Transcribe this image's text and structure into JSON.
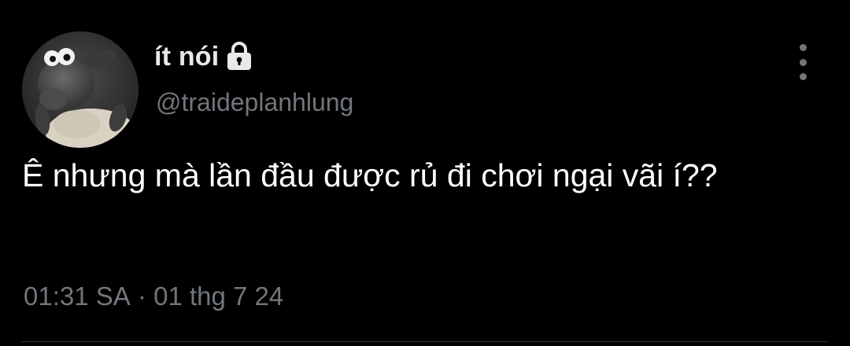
{
  "author": {
    "display_name": "ít nói",
    "handle": "@traideplanhlung",
    "protected_icon": "lock-icon",
    "avatar": "sheep-avatar"
  },
  "tweet": {
    "text": "Ê nhưng mà lần đầu được rủ đi chơi ngại vãi í??",
    "time": "01:31 SA",
    "separator": " · ",
    "date": "01 thg 7 24"
  },
  "menu": {
    "icon": "more-vertical-icon"
  },
  "colors": {
    "background": "#000000",
    "primary_text": "#e7e9ea",
    "secondary_text": "#71767b",
    "divider": "#2f3336"
  }
}
